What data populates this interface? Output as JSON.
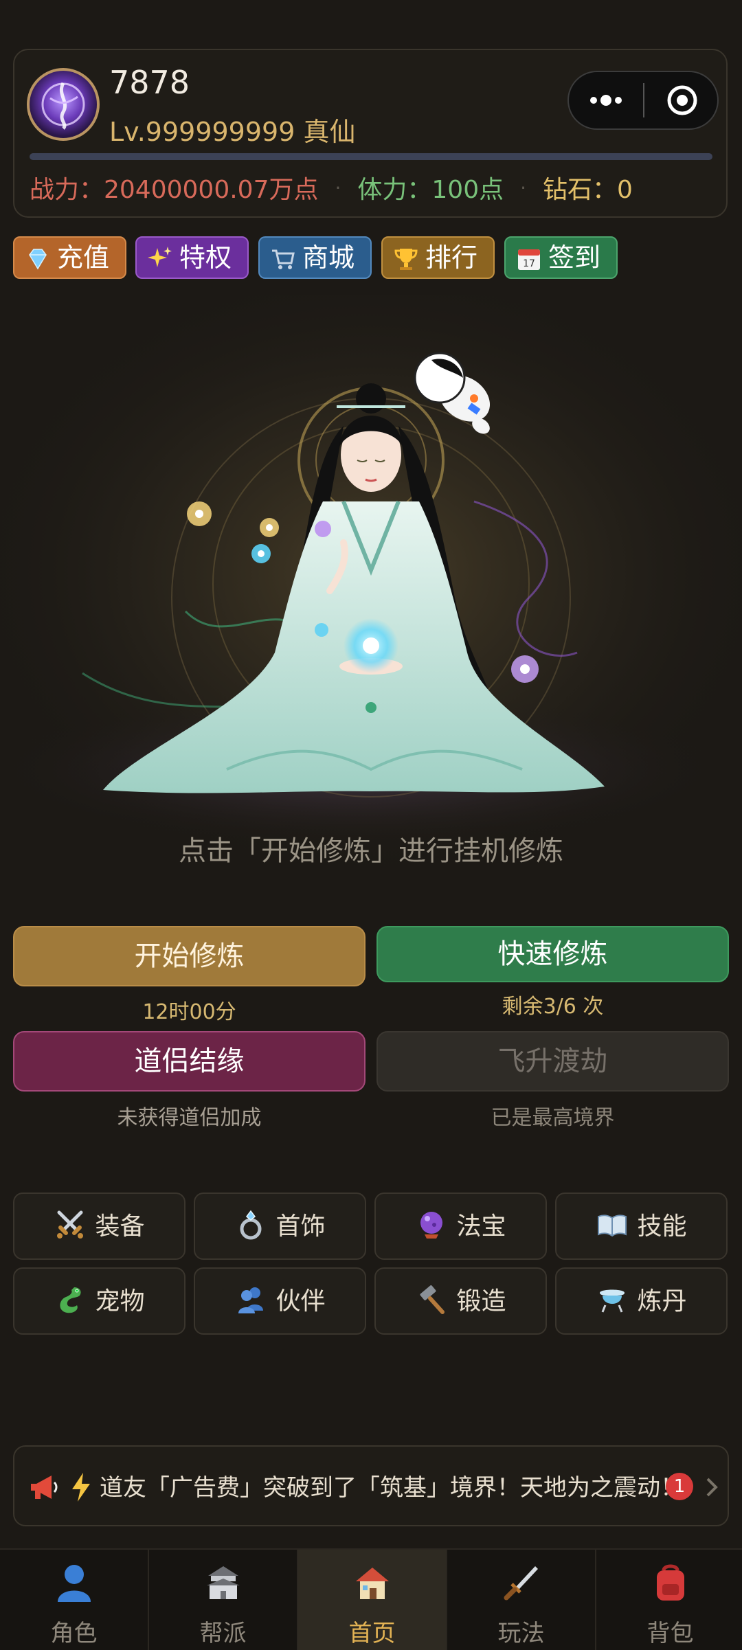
{
  "header": {
    "username": "7878",
    "level": "Lv.999999999 真仙",
    "xp_fraction": 1.0,
    "stats": {
      "power": "战力：20400000.07万点",
      "stamina": "体力：100点",
      "diamond": "钻石：0"
    }
  },
  "chips": [
    {
      "label": "充值",
      "icon": "diamond-icon"
    },
    {
      "label": "特权",
      "icon": "sparkles-icon"
    },
    {
      "label": "商城",
      "icon": "cart-icon"
    },
    {
      "label": "排行",
      "icon": "trophy-icon"
    },
    {
      "label": "签到",
      "icon": "calendar-icon"
    }
  ],
  "stage": {
    "hint": "点击「开始修炼」进行挂机修炼"
  },
  "actions": {
    "cultivate": {
      "label": "开始修炼",
      "sub": "12时00分"
    },
    "fast": {
      "label": "快速修炼",
      "sub": "剩余3/6 次"
    },
    "dao": {
      "label": "道侣结缘",
      "sub": "未获得道侣加成"
    },
    "ascend": {
      "label": "飞升渡劫",
      "sub": "已是最高境界"
    }
  },
  "grid": [
    {
      "label": "装备",
      "icon": "crossed-swords-icon"
    },
    {
      "label": "首饰",
      "icon": "ring-icon"
    },
    {
      "label": "法宝",
      "icon": "crystal-ball-icon"
    },
    {
      "label": "技能",
      "icon": "book-icon"
    },
    {
      "label": "宠物",
      "icon": "dragon-icon"
    },
    {
      "label": "伙伴",
      "icon": "people-icon"
    },
    {
      "label": "锻造",
      "icon": "hammer-icon"
    },
    {
      "label": "炼丹",
      "icon": "flask-icon"
    }
  ],
  "news": {
    "text": "道友「广告费」突破到了「筑基」境界！天地为之震动！",
    "badge": "1"
  },
  "nav": [
    {
      "label": "角色",
      "icon": "person-icon"
    },
    {
      "label": "帮派",
      "icon": "castle-icon"
    },
    {
      "label": "首页",
      "icon": "house-icon",
      "active": true
    },
    {
      "label": "玩法",
      "icon": "dagger-icon"
    },
    {
      "label": "背包",
      "icon": "backpack-icon"
    }
  ],
  "colors": {
    "background": "#1c1915",
    "gold": "#d9b56d",
    "power": "#d86a5a",
    "stamina": "#79c27a",
    "active_nav": "#e3b354"
  }
}
